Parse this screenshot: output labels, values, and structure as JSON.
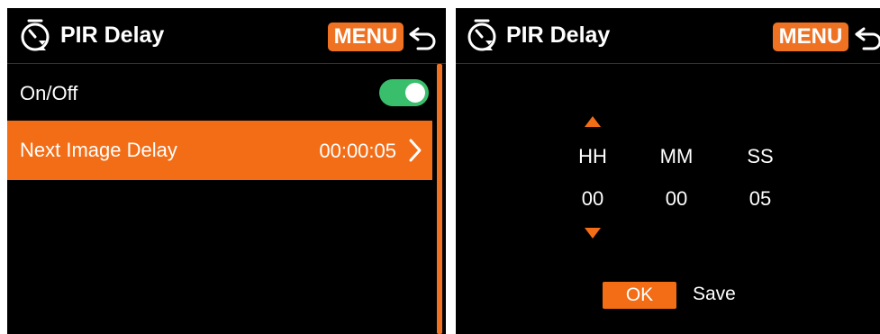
{
  "left_screen": {
    "header": {
      "title": "PIR Delay",
      "menu_label": "MENU",
      "clock_icon": "timer-clock-icon",
      "back_icon": "back-arrow-icon"
    },
    "rows": [
      {
        "label": "On/Off",
        "toggle_on": true
      },
      {
        "label": "Next Image Delay",
        "value": "00:00:05",
        "selected": true
      }
    ]
  },
  "right_screen": {
    "header": {
      "title": "PIR Delay",
      "menu_label": "MENU",
      "clock_icon": "timer-clock-icon",
      "back_icon": "back-arrow-icon"
    },
    "time_picker": {
      "columns": [
        {
          "label": "HH",
          "value": "00"
        },
        {
          "label": "MM",
          "value": "00"
        },
        {
          "label": "SS",
          "value": "05"
        }
      ],
      "active_column": "HH"
    },
    "ok_label": "OK",
    "save_label": "Save"
  },
  "colors": {
    "accent": "#f26d16",
    "menu": "#ef7222",
    "toggle_on": "#39bf6b",
    "background": "#000000"
  }
}
